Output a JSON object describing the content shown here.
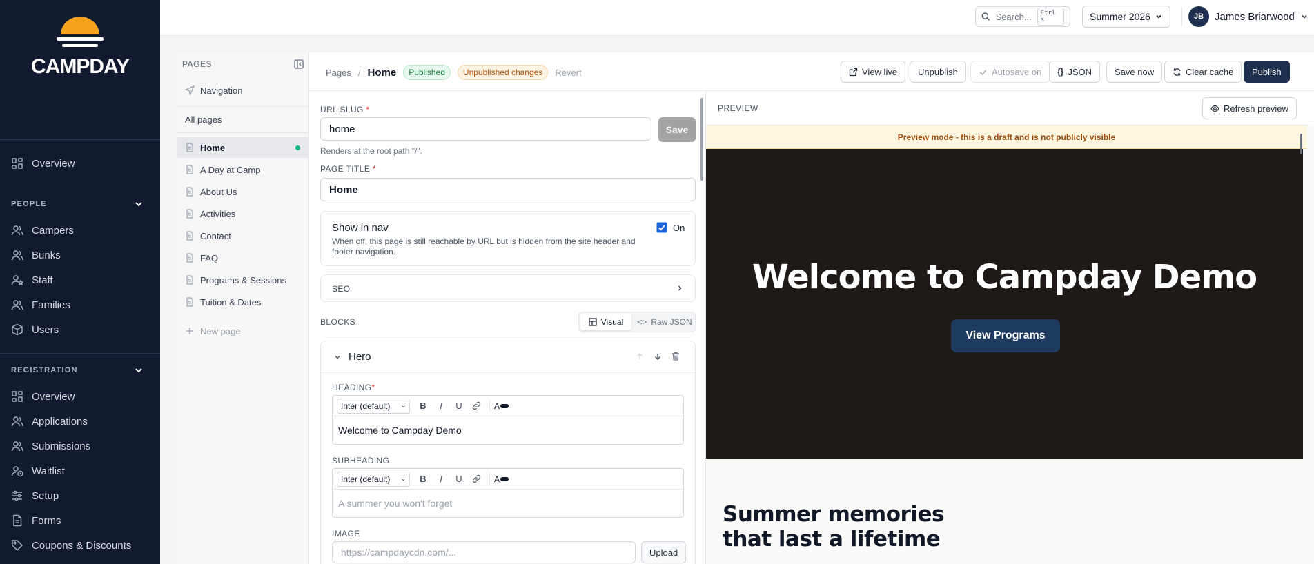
{
  "brand": {
    "name": "CAMPDAY"
  },
  "sidebar": {
    "overview": "Overview",
    "people_group": "PEOPLE",
    "people": [
      "Campers",
      "Bunks",
      "Staff",
      "Families",
      "Users"
    ],
    "registration_group": "REGISTRATION",
    "registration": [
      "Overview",
      "Applications",
      "Submissions",
      "Waitlist",
      "Setup",
      "Forms",
      "Coupons & Discounts"
    ]
  },
  "topbar": {
    "search_placeholder": "Search...",
    "search_shortcut": "Ctrl K",
    "season": "Summer 2026",
    "user_initials": "JB",
    "user_name": "James Briarwood"
  },
  "pages_panel": {
    "title": "PAGES",
    "navigation": "Navigation",
    "all_pages": "All pages",
    "pages": [
      "Home",
      "A Day at Camp",
      "About Us",
      "Activities",
      "Contact",
      "FAQ",
      "Programs & Sessions",
      "Tuition & Dates"
    ],
    "active_page": "Home",
    "new_page": "New page"
  },
  "header": {
    "crumb_root": "Pages",
    "crumb_sep": "/",
    "crumb_current": "Home",
    "badge_published": "Published",
    "badge_unpublished": "Unpublished changes",
    "revert": "Revert",
    "buttons": {
      "view_live": "View live",
      "unpublish": "Unpublish",
      "autosave": "Autosave on",
      "json": "JSON",
      "save_now": "Save now",
      "clear_cache": "Clear cache",
      "publish": "Publish"
    }
  },
  "form": {
    "url_slug_label": "URL SLUG",
    "url_slug_value": "home",
    "save": "Save",
    "url_hint": "Renders at the root path \"/\".",
    "page_title_label": "PAGE TITLE",
    "page_title_value": "Home",
    "show_in_nav_title": "Show in nav",
    "show_in_nav_desc": "When off, this page is still reachable by URL but is hidden from the site header and footer navigation.",
    "show_in_nav_state": "On",
    "seo": "SEO",
    "blocks_label": "BLOCKS",
    "mode_visual": "Visual",
    "mode_raw": "Raw JSON",
    "block_name": "Hero",
    "heading_label": "HEADING",
    "heading_font": "Inter (default)",
    "heading_value": "Welcome to Campday Demo",
    "subheading_label": "SUBHEADING",
    "subheading_font": "Inter (default)",
    "subheading_placeholder": "A summer you won't forget",
    "image_label": "IMAGE",
    "image_placeholder": "https://campdaycdn.com/...",
    "upload": "Upload"
  },
  "preview": {
    "label": "PREVIEW",
    "refresh": "Refresh preview",
    "draft_notice": "Preview mode - this is a draft and is not publicly visible",
    "hero_title": "Welcome to Campday Demo",
    "hero_button": "View Programs",
    "section_title": "Summer memories that last a lifetime"
  },
  "colors": {
    "sidebar_bg": "#111a2e",
    "primary": "#1e2f4f",
    "published": "#15803d",
    "unpublished": "#b45309"
  }
}
